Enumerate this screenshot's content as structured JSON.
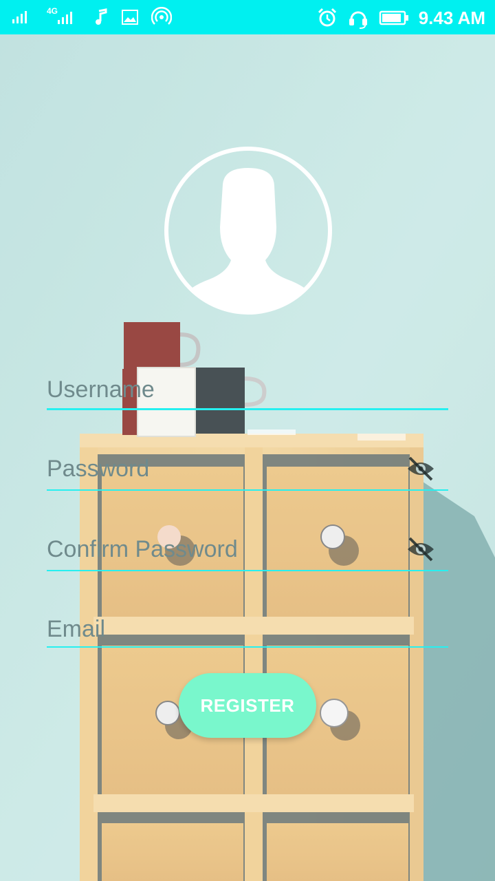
{
  "status_bar": {
    "time": "9.43 AM",
    "network_label": "4G"
  },
  "form": {
    "username_placeholder": "Username",
    "password_placeholder": "Password",
    "confirm_password_placeholder": "Confirm Password",
    "email_placeholder": "Email",
    "register_label": "REGISTER"
  },
  "colors": {
    "status_bar": "#00f0f0",
    "accent_line": "#26f0f0",
    "register_button": "#79f7cc"
  },
  "icons": {
    "avatar": "user-placeholder-icon",
    "password_toggle": "eye-off-icon"
  }
}
